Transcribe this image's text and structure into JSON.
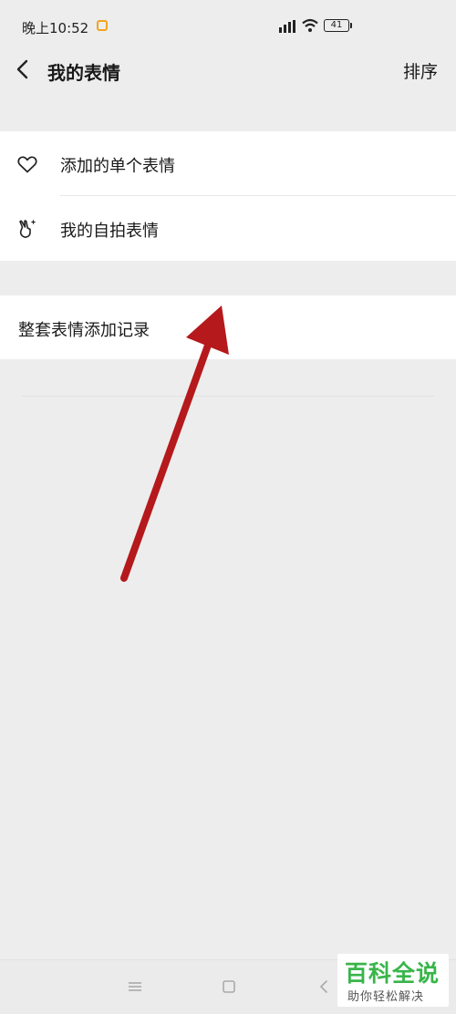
{
  "status_bar": {
    "time": "晚上10:52",
    "battery": "41"
  },
  "header": {
    "title": "我的表情",
    "sort_label": "排序"
  },
  "list": {
    "group1": [
      {
        "label": "添加的单个表情",
        "icon": "heart-icon"
      },
      {
        "label": "我的自拍表情",
        "icon": "selfie-hand-icon"
      }
    ],
    "group2": [
      {
        "label": "整套表情添加记录"
      }
    ]
  },
  "annotation": {
    "arrow_color": "#b5191c"
  },
  "watermark": {
    "main": "百科全说",
    "sub": "助你轻松解决",
    "color": "#39b54a"
  },
  "colors": {
    "background": "#ededed",
    "card": "#ffffff",
    "text": "#191919"
  }
}
